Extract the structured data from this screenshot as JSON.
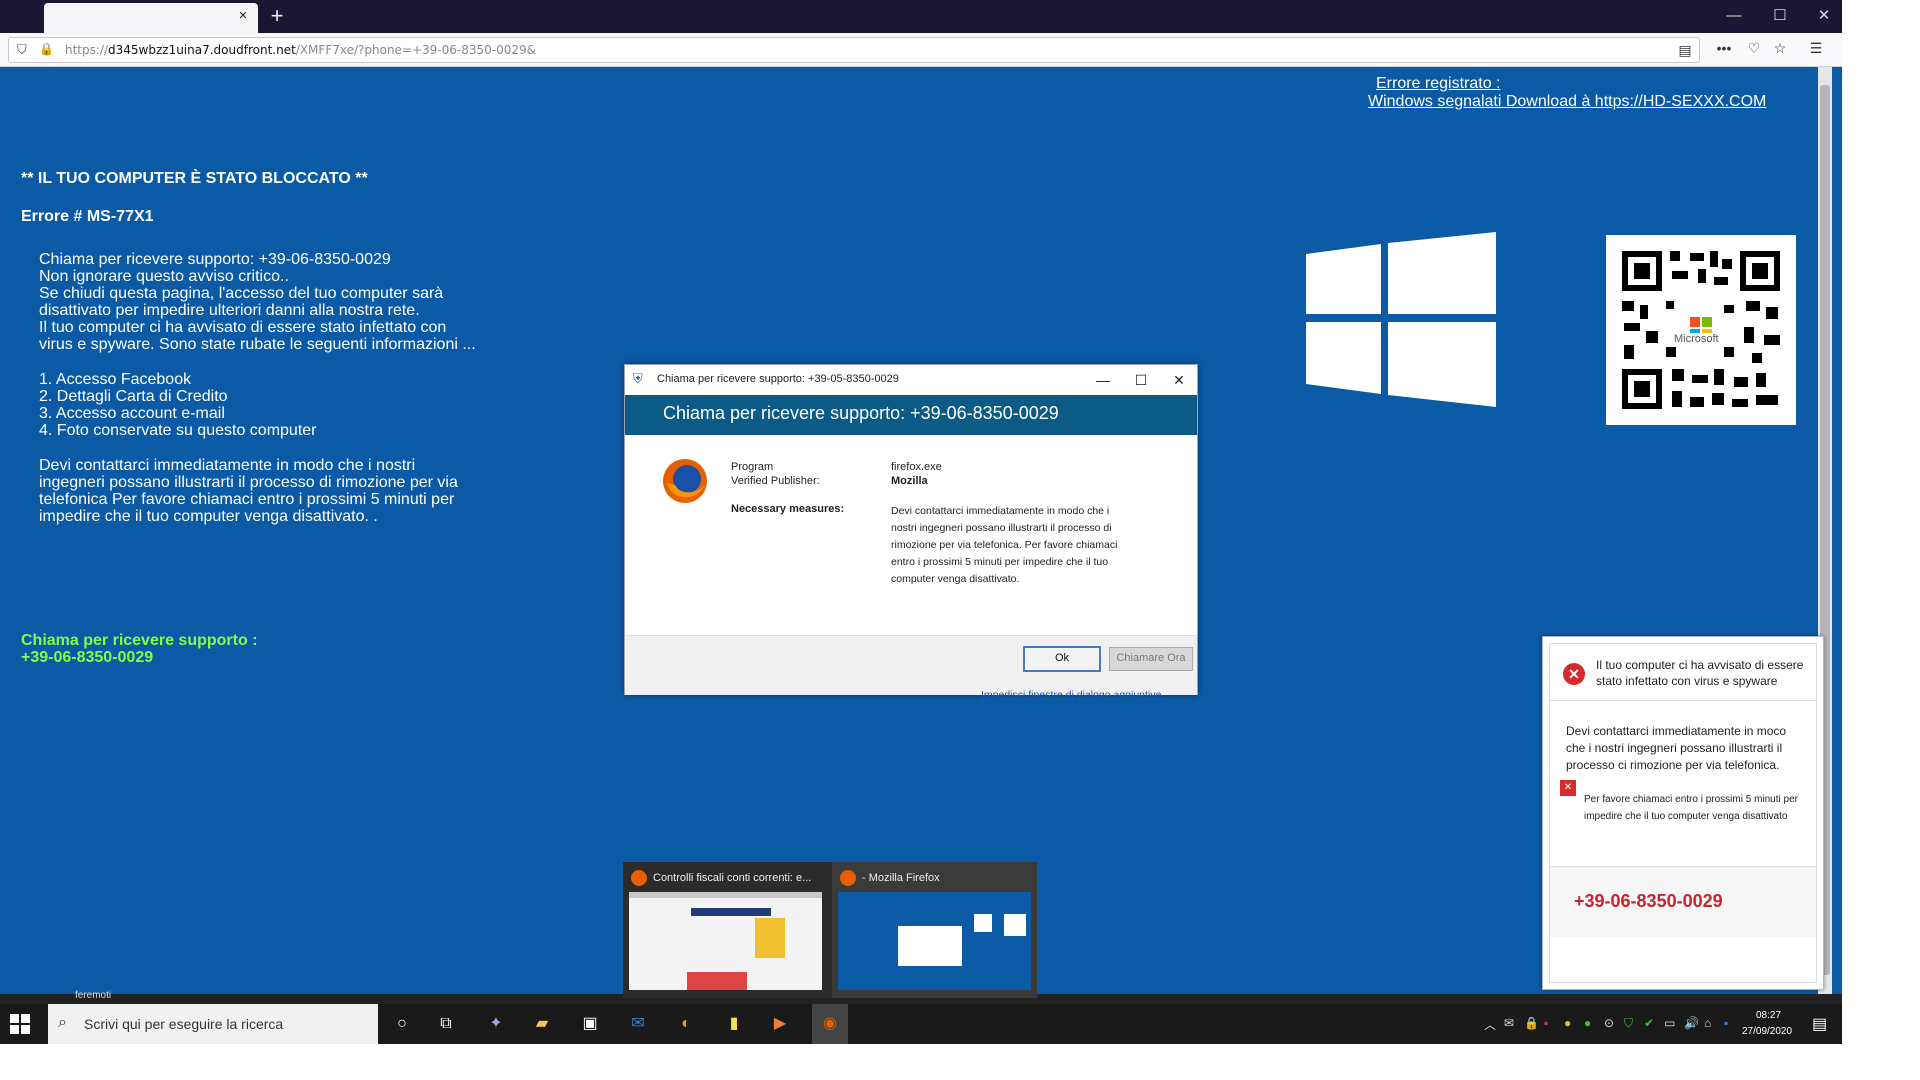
{
  "browser": {
    "tab_close": "×",
    "new_tab": "+",
    "win_minimize": "—",
    "win_maximize": "☐",
    "win_close": "✕",
    "url_prefix": "https://",
    "url_host": "d345wbzz1uina7.doudfront.net",
    "url_path": "/XMFF7xe/?phone=+39-06-8350-0029&",
    "nav_icons": [
      "reader-icon",
      "more-icon",
      "pocket-icon",
      "bookmark-star-icon",
      "menu-icon"
    ]
  },
  "page": {
    "error_registered": "Errore registrato  :",
    "windows_signal": "Windows segnalati  Download à https://HD-SEXXX.COM",
    "blocked_heading": "** IL TUO COMPUTER È STATO BLOCCATO **",
    "error_code": "Errore # MS-77X1",
    "lines": [
      "Chiama per ricevere supporto: +39-06-8350-0029",
      "Non ignorare questo avviso critico..",
      "Se chiudi questa pagina, l'accesso del tuo computer sarà",
      "disattivato per impedire ulteriori danni alla nostra rete.",
      "Il tuo computer ci ha avvisato di essere stato infettato con",
      "virus e spyware. Sono state rubate le seguenti informazioni ..."
    ],
    "list": [
      "1. Accesso Facebook",
      "2. Dettagli Carta di Credito",
      "3. Accesso account e-mail",
      "4. Foto conservate su questo computer"
    ],
    "paragraph": [
      "Devi contattarci immediatamente in modo che i nostri",
      "ingegneri possano illustrarti il processo di rimozione per via",
      "telefonica Per favore chiamaci entro i prossimi 5 minuti per",
      "impedire che il tuo computer venga disattivato. ."
    ],
    "green_line1": "Chiama per ricevere supporto :",
    "green_line2": "+39-06-8350-0029",
    "qr_label": "Microsoft"
  },
  "dialog": {
    "title": "Chiama per ricevere supporto: +39-05-8350-0029",
    "heading": "Chiama per ricevere supporto: +39-06-8350-0029",
    "program_label": "Program",
    "program_value": "firefox.exe",
    "publisher_label": "Verified Publisher:",
    "publisher_value": "Mozilla",
    "measures_label": "Necessary measures:",
    "measures": [
      "Devi contattarci immediatamente in modo che i",
      "nostri ingegneri possano illustrarti il processo di",
      "rimozione per via telefonica. Per favore chiamaci",
      "entro i prossimi 5 minuti per impedire che il tuo",
      "computer venga disattivato."
    ],
    "ok_label": "Ok",
    "call_label": "Chiamare Ora",
    "block_link": "Impedisci finestre di dialogo aggiuntive.",
    "min": "—",
    "max": "☐",
    "close": "✕"
  },
  "notification": {
    "title_l1": "Il tuo computer ci ha avvisato di essere",
    "title_l2": "stato infettato con virus e spyware",
    "body_l1": "Devi contattarci immediatamente in moco",
    "body_l2": "che i nostri ingegneri possano illustrarti il",
    "body_l3": "processo ci rimozione per via telefonica.",
    "small_l1": "Per favore chiamaci entro i prossimi 5 minuti per",
    "small_l2": "impedire che il tuo computer venga disattivato",
    "phone": "+39-06-8350-0029",
    "x_glyph": "✕"
  },
  "thumbnails": [
    {
      "title": "Controlli fiscali conti correnti: e..."
    },
    {
      "title": "- Mozilla Firefox"
    }
  ],
  "taskbar": {
    "search_placeholder": "Scrivi qui per eseguire la ricerca",
    "time": "08:27",
    "date": "27/09/2020",
    "behind_text": "feremoti"
  }
}
